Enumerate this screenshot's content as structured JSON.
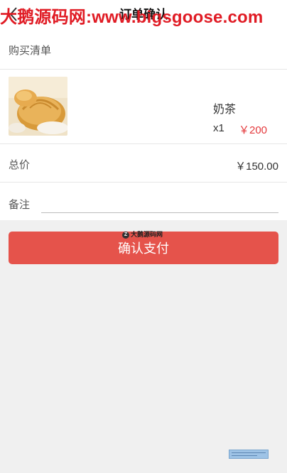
{
  "watermark": "大鹅源码网:www.bigsgoose.com",
  "header": {
    "title": "订单确认",
    "back_icon": "chevron-left-icon"
  },
  "purchase_list": {
    "title": "购买清单",
    "items": [
      {
        "name": "奶茶",
        "quantity": "x1",
        "price": "￥200",
        "image": "pumpkin-bread-image"
      }
    ]
  },
  "total": {
    "label": "总价",
    "value": "￥150.00"
  },
  "remark": {
    "label": "备注",
    "value": "",
    "placeholder": ""
  },
  "pay_button": {
    "label": "确认支付"
  },
  "small_watermark": "大鹅源码网",
  "colors": {
    "accent": "#e5534b",
    "price": "#e4393c",
    "watermark": "#e01b24"
  }
}
